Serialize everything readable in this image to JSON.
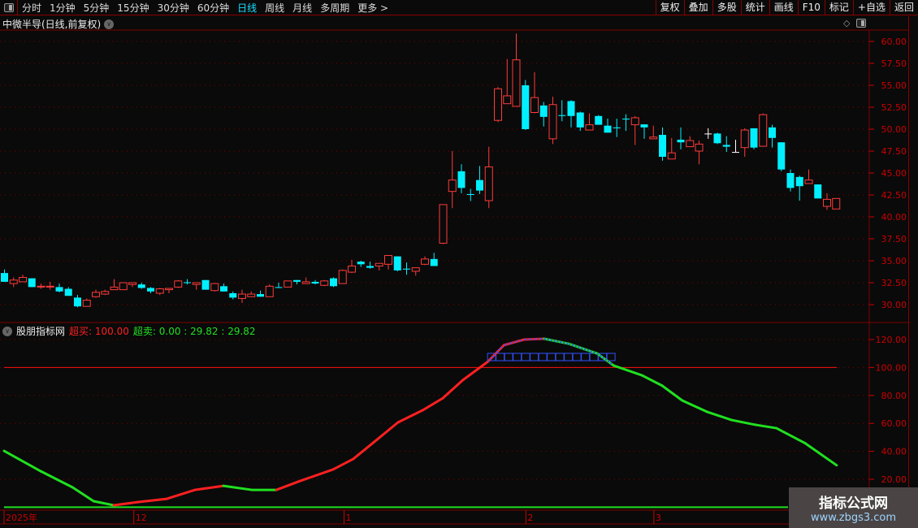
{
  "toolbar": {
    "tabs": [
      "分时",
      "1分钟",
      "5分钟",
      "15分钟",
      "30分钟",
      "60分钟",
      "日线",
      "周线",
      "月线",
      "多周期",
      "更多 >"
    ],
    "active": "日线",
    "right_buttons": [
      "复权",
      "叠加",
      "多股",
      "统计",
      "画线",
      "F10",
      "标记",
      "+自选",
      "返回"
    ]
  },
  "chart_title": "中微半导(日线,前复权)",
  "price_axis": {
    "ticks": [
      "60.00",
      "57.50",
      "55.00",
      "52.50",
      "50.00",
      "47.50",
      "45.00",
      "42.50",
      "40.00",
      "37.50",
      "35.00",
      "32.50",
      "30.00"
    ],
    "range": [
      30,
      60
    ]
  },
  "indicator": {
    "name": "股朋指标网",
    "overbought_label": "超买:",
    "overbought_value": "100.00",
    "oversold_label": "超卖:",
    "oversold_value": "0.00",
    "v1": ": 29.82",
    "v2": ": 29.82",
    "ticks": [
      "120.00",
      "100.00",
      "80.00",
      "60.00",
      "40.00",
      "20.00"
    ],
    "range": [
      0,
      120
    ],
    "line": [
      [
        0,
        40.3
      ],
      [
        4,
        25.8
      ],
      [
        7.5,
        14.2
      ],
      [
        9.8,
        4.3
      ],
      [
        12,
        1.4
      ],
      [
        14.7,
        3.7
      ],
      [
        17.8,
        6
      ],
      [
        20.9,
        12.4
      ],
      [
        24,
        15.3
      ],
      [
        27.1,
        12.4
      ],
      [
        29.8,
        12.4
      ],
      [
        32.4,
        18.8
      ],
      [
        36,
        27
      ],
      [
        38.2,
        34.5
      ],
      [
        40.4,
        46.2
      ],
      [
        43.1,
        60.7
      ],
      [
        45.8,
        69.4
      ],
      [
        48,
        78
      ],
      [
        50.2,
        91
      ],
      [
        52.9,
        104
      ],
      [
        54.7,
        116
      ],
      [
        56.9,
        120
      ],
      [
        59.1,
        120.6
      ],
      [
        61.8,
        117
      ],
      [
        64.9,
        110
      ],
      [
        66.7,
        101.4
      ],
      [
        69.8,
        94.4
      ],
      [
        72,
        87
      ],
      [
        74.2,
        76.4
      ],
      [
        76.9,
        68.3
      ],
      [
        79.6,
        62.4
      ],
      [
        82.2,
        59
      ],
      [
        84.5,
        56.6
      ],
      [
        87.6,
        46
      ],
      [
        91.1,
        30
      ]
    ],
    "colors": {
      "up": "#ff2020",
      "down": "#20e020",
      "over": "#3050ff"
    }
  },
  "date_axis": [
    {
      "label": "2025年",
      "bar": 0
    },
    {
      "label": "12",
      "bar": 14.2
    },
    {
      "label": "1",
      "bar": 37.2
    },
    {
      "label": "2",
      "bar": 57.1
    },
    {
      "label": "3",
      "bar": 71.1
    }
  ],
  "colors": {
    "up": "#ff3b3b",
    "down": "#00f0ff",
    "doji": "#ffffff",
    "axis": "#cc0000",
    "grid": "#800000"
  },
  "candles": [
    [
      33.6,
      34.0,
      32.6,
      32.6
    ],
    [
      32.4,
      33.1,
      32.0,
      32.8
    ],
    [
      32.6,
      33.4,
      32.6,
      33.1
    ],
    [
      33.0,
      33.0,
      32.0,
      32.0
    ],
    [
      32.0,
      32.4,
      31.8,
      32.1
    ],
    [
      32.0,
      32.6,
      31.7,
      32.1
    ],
    [
      32.0,
      32.4,
      31.4,
      31.5
    ],
    [
      31.8,
      32.0,
      31.0,
      31.0
    ],
    [
      30.8,
      31.1,
      29.7,
      29.8
    ],
    [
      29.8,
      30.7,
      29.8,
      30.5
    ],
    [
      30.9,
      31.7,
      30.8,
      31.4
    ],
    [
      31.2,
      31.7,
      31.1,
      31.5
    ],
    [
      31.7,
      32.9,
      31.7,
      32.0
    ],
    [
      31.7,
      32.5,
      31.7,
      32.5
    ],
    [
      32.3,
      32.5,
      32.0,
      32.5
    ],
    [
      32.3,
      32.5,
      31.8,
      31.9
    ],
    [
      31.9,
      32.0,
      31.3,
      31.5
    ],
    [
      31.3,
      31.9,
      31.1,
      31.8
    ],
    [
      31.7,
      31.9,
      31.3,
      31.85
    ],
    [
      32.0,
      32.8,
      31.9,
      32.7
    ],
    [
      32.55,
      32.9,
      32.3,
      32.45
    ],
    [
      32.3,
      32.5,
      31.7,
      32.5
    ],
    [
      32.8,
      32.8,
      31.7,
      31.7
    ],
    [
      31.6,
      32.4,
      31.5,
      32.4
    ],
    [
      32.1,
      32.4,
      31.5,
      31.5
    ],
    [
      31.3,
      31.5,
      30.6,
      30.8
    ],
    [
      30.7,
      31.7,
      30.2,
      31.2
    ],
    [
      30.9,
      31.5,
      30.9,
      31.2
    ],
    [
      31.2,
      31.6,
      30.9,
      30.9
    ],
    [
      30.9,
      32.3,
      30.9,
      32.1
    ],
    [
      32.0,
      32.5,
      31.9,
      31.9
    ],
    [
      32.0,
      32.7,
      32.0,
      32.7
    ],
    [
      32.8,
      32.8,
      32.3,
      32.6
    ],
    [
      32.4,
      33.1,
      32.4,
      32.6
    ],
    [
      32.6,
      32.8,
      32.3,
      32.4
    ],
    [
      32.2,
      32.8,
      32.1,
      32.7
    ],
    [
      33.0,
      33.1,
      32.0,
      32.1
    ],
    [
      32.4,
      34.0,
      32.4,
      33.9
    ],
    [
      33.7,
      35.1,
      33.6,
      34.4
    ],
    [
      34.9,
      35.0,
      34.3,
      34.6
    ],
    [
      34.4,
      34.9,
      34.1,
      34.2
    ],
    [
      34.4,
      34.7,
      33.9,
      34.7
    ],
    [
      34.6,
      35.6,
      34.0,
      35.6
    ],
    [
      35.5,
      35.5,
      33.8,
      33.9
    ],
    [
      34.1,
      34.8,
      33.4,
      34.0
    ],
    [
      33.8,
      34.2,
      33.3,
      34.2
    ],
    [
      34.6,
      35.5,
      34.5,
      35.2
    ],
    [
      35.2,
      35.9,
      34.4,
      34.4
    ],
    [
      37.0,
      41.4,
      36.9,
      41.4
    ],
    [
      42.9,
      47.5,
      41.0,
      44.2
    ],
    [
      45.2,
      46.0,
      42.7,
      43.3
    ],
    [
      42.6,
      43.2,
      41.8,
      42.5
    ],
    [
      44.2,
      45.8,
      42.6,
      43.0
    ],
    [
      41.85,
      48.0,
      41.0,
      45.7
    ],
    [
      51.0,
      54.8,
      50.8,
      54.6
    ],
    [
      52.9,
      58.0,
      52.9,
      53.8
    ],
    [
      52.6,
      60.9,
      52.6,
      57.9
    ],
    [
      55.0,
      55.6,
      49.9,
      50.0
    ],
    [
      51.9,
      56.5,
      51.8,
      53.6
    ],
    [
      52.7,
      53.1,
      50.3,
      51.4
    ],
    [
      48.9,
      53.7,
      48.3,
      52.8
    ],
    [
      51.6,
      53.3,
      50.9,
      51.5
    ],
    [
      53.2,
      53.3,
      50.2,
      51.5
    ],
    [
      51.9,
      52.0,
      49.8,
      50.2
    ],
    [
      49.9,
      51.8,
      49.9,
      50.5
    ],
    [
      51.5,
      51.6,
      50.5,
      50.5
    ],
    [
      50.4,
      51.2,
      49.6,
      49.6
    ],
    [
      50.2,
      51.2,
      49.1,
      50.1
    ],
    [
      51.2,
      51.7,
      49.8,
      51.1
    ],
    [
      50.5,
      51.5,
      48.2,
      51.3
    ],
    [
      50.55,
      50.55,
      48.9,
      50.2
    ],
    [
      48.9,
      50.4,
      48.9,
      49.1
    ],
    [
      49.35,
      50.2,
      46.4,
      46.85
    ],
    [
      46.6,
      49.0,
      46.6,
      47.3
    ],
    [
      48.8,
      50.2,
      47.7,
      48.5
    ],
    [
      48.0,
      49.2,
      48.0,
      48.7
    ],
    [
      47.5,
      48.7,
      46.0,
      48.3
    ],
    [
      49.5,
      50.1,
      48.9,
      49.5
    ],
    [
      49.5,
      49.6,
      48.3,
      48.4
    ],
    [
      48.2,
      49.2,
      47.4,
      48.0
    ],
    [
      47.4,
      48.8,
      47.4,
      47.4
    ],
    [
      47.9,
      50.1,
      46.85,
      49.9
    ],
    [
      50.1,
      50.1,
      47.7,
      47.9
    ],
    [
      48.05,
      51.8,
      48.0,
      51.65
    ],
    [
      50.2,
      50.5,
      47.9,
      49.0
    ],
    [
      48.5,
      48.5,
      45.2,
      45.4
    ],
    [
      45.0,
      45.4,
      42.9,
      43.3
    ],
    [
      44.55,
      44.7,
      41.85,
      43.5
    ],
    [
      43.8,
      45.4,
      43.8,
      44.2
    ],
    [
      43.7,
      43.7,
      42.1,
      42.1
    ],
    [
      41.2,
      42.7,
      40.8,
      42.0
    ],
    [
      40.9,
      42.1,
      40.9,
      42.1
    ]
  ],
  "watermark": {
    "title": "指标公式网",
    "url": "www.zbgs3.com"
  }
}
